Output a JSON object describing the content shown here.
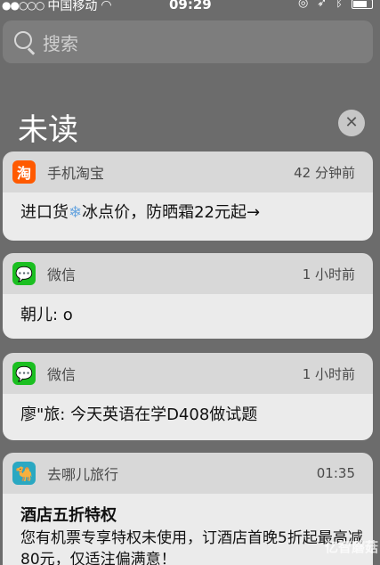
{
  "status_bar": {
    "signal_dots": "●●○○○",
    "carrier": "中国移动",
    "time": "09:29",
    "icons": [
      "wifi-icon",
      "orientation-lock-icon",
      "location-icon",
      "bluetooth-icon",
      "battery-icon"
    ]
  },
  "search": {
    "placeholder": "搜索"
  },
  "section": {
    "title": "未读",
    "clear_label": "✕"
  },
  "notifications": [
    {
      "app": "手机淘宝",
      "icon": "taobao-icon",
      "icon_glyph": "淘",
      "time": "42 分钟前",
      "message": "进口货",
      "message_emoji": "❄",
      "message_rest": "冰点价，防晒霜22元起→"
    },
    {
      "app": "微信",
      "icon": "wechat-icon",
      "time": "1 小时前",
      "message": "朝儿: o"
    },
    {
      "app": "微信",
      "icon": "wechat-icon",
      "time": "1 小时前",
      "message": "廖\"旅: 今天英语在学D408做试题"
    },
    {
      "app": "去哪儿旅行",
      "icon": "qunar-icon",
      "time": "01:35",
      "title": "酒店五折特权",
      "message": "您有机票专享特权未使用，订酒店首晚5折起最高减80元，仅适注偏满意！"
    }
  ],
  "watermark": "亿智蘑菇"
}
